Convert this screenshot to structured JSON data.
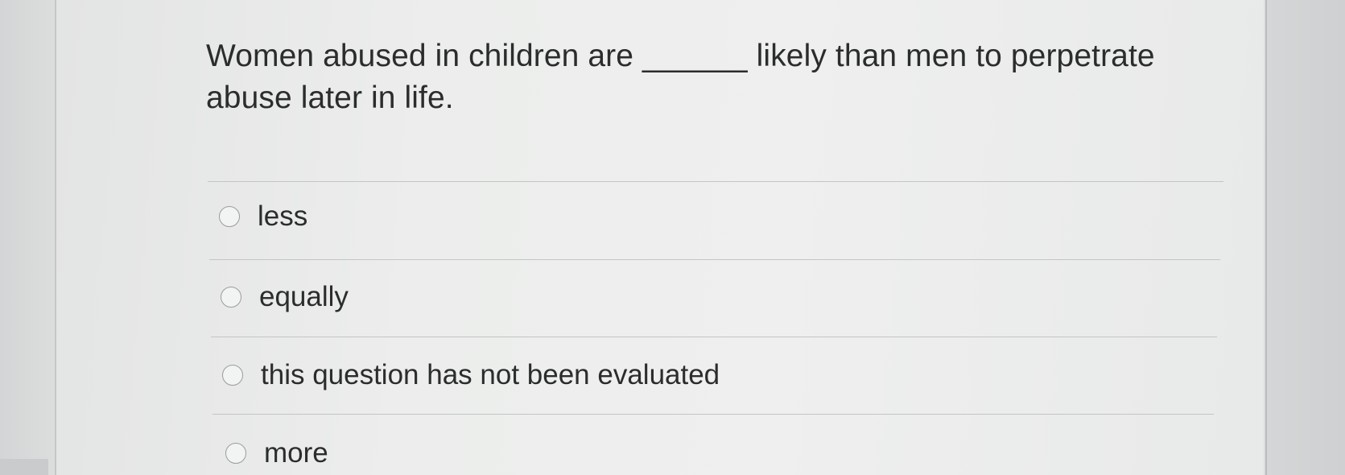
{
  "question": {
    "text": "Women abused in children are ______ likely than men to perpetrate abuse later in life."
  },
  "options": [
    {
      "label": "less",
      "selected": false
    },
    {
      "label": "equally",
      "selected": false
    },
    {
      "label": "this question has not been evaluated",
      "selected": false
    },
    {
      "label": "more",
      "selected": false
    }
  ]
}
